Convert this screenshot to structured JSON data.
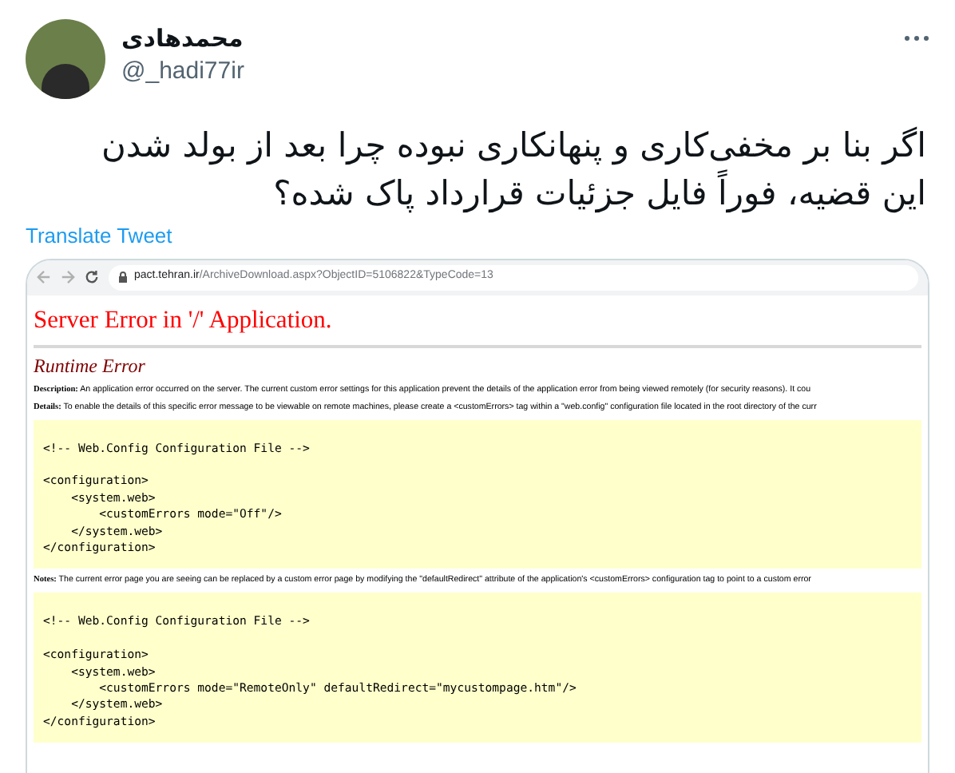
{
  "tweet": {
    "author": "محمدهادی",
    "handle": "@_hadi77ir",
    "text": "اگر بنا بر مخفی‌کاری و پنهانکاری نبوده چرا بعد از بولد شدن این قضیه، فوراً فایل جزئیات قرارداد پاک شده؟",
    "translate_link": "Translate Tweet"
  },
  "screenshot": {
    "address_bar": {
      "url_host": "pact.tehran.ir",
      "url_path": "/ArchiveDownload.aspx?ObjectID=5106822&TypeCode=13"
    },
    "title": "Server Error in '/' Application.",
    "subtitle": "Runtime Error",
    "blocks": [
      {
        "kind": "para",
        "text": "**Description:** An application error occurred on the server. The current custom error settings for this application prevent the details of the application error from being viewed remotely (for security reasons). It cou"
      },
      {
        "kind": "para",
        "text": "**Details:** To enable the details of this specific error message to be viewable on remote machines, please create a <customErrors> tag within a \"web.config\" configuration file located in the root directory of the curr"
      },
      {
        "kind": "code",
        "comment": "<!-- Web.Config Configuration File -->",
        "lines": [
          "<configuration>",
          "    <system.web>",
          "        <customErrors mode=\"Off\"/>",
          "    </system.web>",
          "</configuration>"
        ]
      },
      {
        "kind": "para",
        "text": "**Notes:** The current error page you are seeing can be replaced by a custom error page by modifying the \"defaultRedirect\" attribute of the application's <customErrors> configuration tag to point to a custom error"
      },
      {
        "kind": "code",
        "comment": "<!-- Web.Config Configuration File -->",
        "lines": [
          "<configuration>",
          "    <system.web>",
          "        <customErrors mode=\"RemoteOnly\" defaultRedirect=\"mycustompage.htm\"/>",
          "    </system.web>",
          "</configuration>"
        ]
      }
    ]
  }
}
